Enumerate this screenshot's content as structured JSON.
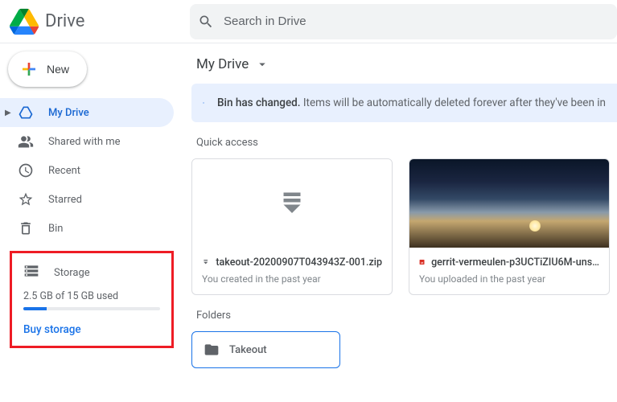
{
  "header": {
    "product": "Drive",
    "search_placeholder": "Search in Drive"
  },
  "new_button": "New",
  "nav": {
    "items": [
      {
        "label": "My Drive",
        "icon": "mydrive-icon"
      },
      {
        "label": "Shared with me",
        "icon": "shared-icon"
      },
      {
        "label": "Recent",
        "icon": "recent-icon"
      },
      {
        "label": "Starred",
        "icon": "starred-icon"
      },
      {
        "label": "Bin",
        "icon": "bin-icon"
      }
    ]
  },
  "storage": {
    "label": "Storage",
    "used_text": "2.5 GB of 15 GB used",
    "buy": "Buy storage"
  },
  "breadcrumb": "My Drive",
  "banner": {
    "title": "Bin has changed.",
    "subtitle": "Items will be automatically deleted forever after they've been in"
  },
  "quick_access": {
    "label": "Quick access",
    "cards": [
      {
        "title": "takeout-20200907T043943Z-001.zip",
        "sub": "You created in the past year",
        "icon": "zip-icon"
      },
      {
        "title": "gerrit-vermeulen-p3UCTiZIU6M-uns…",
        "sub": "You uploaded in the past year",
        "icon": "image-icon"
      }
    ]
  },
  "folders": {
    "label": "Folders",
    "items": [
      {
        "name": "Takeout"
      }
    ]
  }
}
